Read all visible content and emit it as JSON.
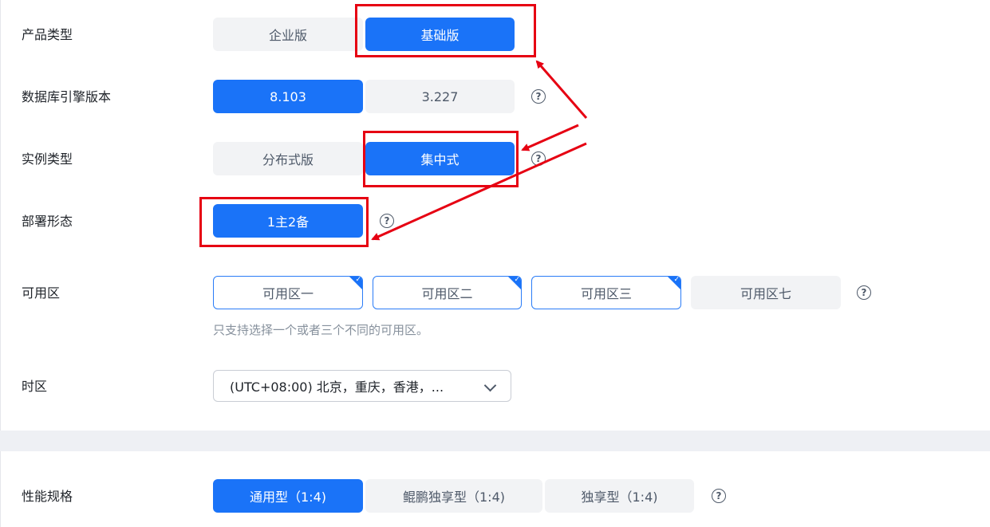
{
  "form": {
    "product_type": {
      "label": "产品类型",
      "options": [
        "企业版",
        "基础版"
      ],
      "selected": "基础版"
    },
    "db_engine": {
      "label": "数据库引擎版本",
      "options": [
        "8.103",
        "3.227"
      ],
      "selected": "8.103"
    },
    "instance_type": {
      "label": "实例类型",
      "options": [
        "分布式版",
        "集中式"
      ],
      "selected": "集中式"
    },
    "deploy_mode": {
      "label": "部署形态",
      "options": [
        "1主2备"
      ],
      "selected": "1主2备"
    },
    "zone": {
      "label": "可用区",
      "options": [
        "可用区一",
        "可用区二",
        "可用区三",
        "可用区七"
      ],
      "selected": [
        "可用区一",
        "可用区二",
        "可用区三"
      ],
      "hint": "只支持选择一个或者三个不同的可用区。"
    },
    "timezone": {
      "label": "时区",
      "value": "(UTC+08:00) 北京，重庆，香港，..."
    },
    "perf_spec": {
      "label": "性能规格",
      "options": [
        "通用型（1:4)",
        "鲲鹏独享型（1:4)",
        "独享型（1:4)"
      ],
      "selected": "通用型（1:4)"
    }
  },
  "help_glyph": "?",
  "check_glyph": "✓",
  "colors": {
    "primary": "#1a73f8",
    "annotation_red": "#e60012",
    "button_bg": "#f2f3f5"
  }
}
